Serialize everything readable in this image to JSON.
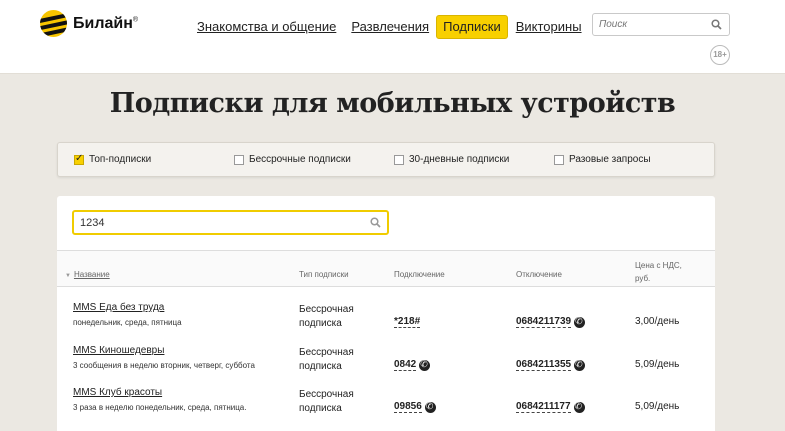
{
  "brand": {
    "name": "Билайн",
    "mark": "®"
  },
  "nav": [
    {
      "label": "Знакомства и общение"
    },
    {
      "label": "Развлечения"
    },
    {
      "label": "Подписки"
    },
    {
      "label": "Викторины"
    }
  ],
  "top_search": {
    "placeholder": "Поиск",
    "icon": "search-icon"
  },
  "age_rating": "18+",
  "page_title": "Подписки для мобильных устройств",
  "filters": [
    {
      "label": "Топ-подписки",
      "checked": true
    },
    {
      "label": "Бессрочные подписки",
      "checked": false
    },
    {
      "label": "30-дневные подписки",
      "checked": false
    },
    {
      "label": "Разовые запросы",
      "checked": false
    }
  ],
  "main_search": {
    "value": "1234",
    "icon": "search-icon"
  },
  "table": {
    "columns": {
      "name": "Название",
      "type": "Тип подписки",
      "connect": "Подключение",
      "disconnect": "Отключение",
      "price": "Цена с НДС, руб."
    },
    "rows": [
      {
        "title": "MMS Еда без труда",
        "days": "понедельник, среда, пятница",
        "type": "Бессрочная подписка",
        "connect": "*218#",
        "connect_call": false,
        "disconnect": "0684211739",
        "price": "3,00/день"
      },
      {
        "title": "MMS Киношедевры",
        "days": "3 сообщения в неделю вторник, четверг, суббота",
        "type": "Бессрочная подписка",
        "connect": "0842",
        "connect_call": true,
        "disconnect": "0684211355",
        "price": "5,09/день"
      },
      {
        "title": "MMS Клуб красоты",
        "days": "3 раза в неделю понедельник, среда, пятница.",
        "type": "Бессрочная подписка",
        "connect": "09856",
        "connect_call": true,
        "disconnect": "0684211177",
        "price": "5,09/день"
      }
    ]
  },
  "colors": {
    "accent": "#f8d000",
    "background": "#ebe8e2",
    "text": "#222222"
  }
}
